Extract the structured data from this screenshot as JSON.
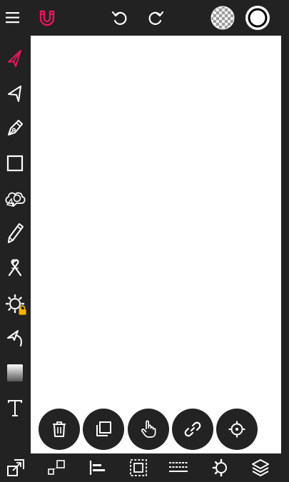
{
  "app": {
    "accent_color": "#e8175d",
    "toolbar_background": "#222222",
    "canvas_background": "#ffffff",
    "icon_color": "#ffffff",
    "lock_badge_color": "#f5b400"
  },
  "top_bar": {
    "items": [
      {
        "name": "menu",
        "icon": "hamburger-icon"
      },
      {
        "name": "snap",
        "icon": "magnet-icon",
        "active": true
      },
      {
        "name": "undo",
        "icon": "undo-icon"
      },
      {
        "name": "redo",
        "icon": "redo-icon"
      },
      {
        "name": "fill",
        "icon": "transparent-fill-icon"
      },
      {
        "name": "stroke",
        "icon": "stroke-color-icon"
      }
    ]
  },
  "left_toolbar": {
    "tools": [
      {
        "name": "select",
        "icon": "select-arrow-icon",
        "active": true
      },
      {
        "name": "direct-select",
        "icon": "direct-select-icon",
        "active": false
      },
      {
        "name": "pen",
        "icon": "pen-nib-icon",
        "active": false
      },
      {
        "name": "rectangle",
        "icon": "rectangle-icon",
        "active": false
      },
      {
        "name": "shapes",
        "icon": "shapes-icon",
        "active": false
      },
      {
        "name": "pencil",
        "icon": "pencil-icon",
        "active": false
      },
      {
        "name": "ribbon",
        "icon": "ribbon-icon",
        "active": false
      },
      {
        "name": "spiro",
        "icon": "spiro-gear-icon",
        "active": false,
        "locked": true
      },
      {
        "name": "path-arrow",
        "icon": "path-arrow-icon",
        "active": false
      },
      {
        "name": "gradient",
        "icon": "gradient-icon",
        "active": false
      },
      {
        "name": "text",
        "icon": "text-icon",
        "active": false
      }
    ]
  },
  "floating_actions": [
    {
      "name": "delete",
      "icon": "trash-icon"
    },
    {
      "name": "duplicate",
      "icon": "duplicate-icon"
    },
    {
      "name": "pan",
      "icon": "hand-pointer-icon"
    },
    {
      "name": "link",
      "icon": "link-icon"
    },
    {
      "name": "center",
      "icon": "crosshair-icon"
    }
  ],
  "bottom_bar": {
    "items": [
      {
        "name": "resize",
        "icon": "resize-icon"
      },
      {
        "name": "position",
        "icon": "position-icon"
      },
      {
        "name": "align",
        "icon": "align-left-icon"
      },
      {
        "name": "bounding-box",
        "icon": "bounding-box-icon"
      },
      {
        "name": "keyboard",
        "icon": "keyboard-icon"
      },
      {
        "name": "settings",
        "icon": "settings-gear-icon"
      },
      {
        "name": "layers",
        "icon": "layers-icon"
      }
    ]
  }
}
